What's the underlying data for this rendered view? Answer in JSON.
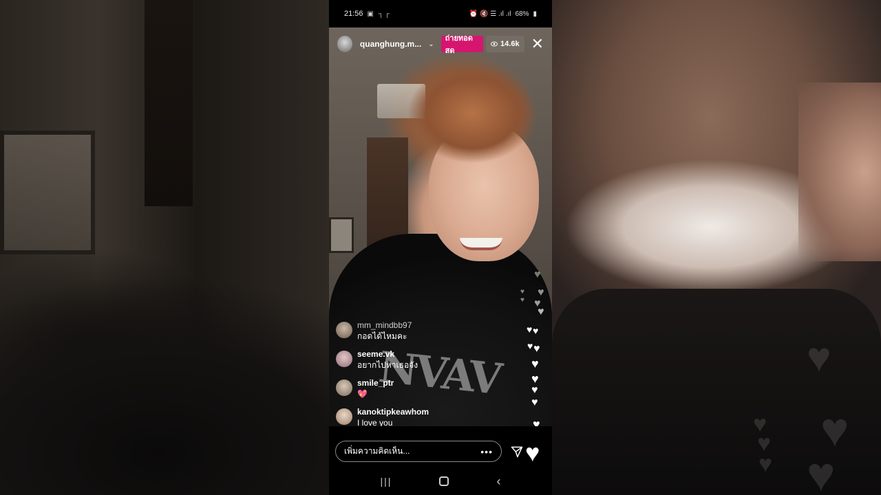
{
  "statusbar": {
    "time": "21:56",
    "left_icons": "▣ ┐┌",
    "right_icons": "⏰ 🔇 ☰ .ıl .ıl",
    "battery": "68%"
  },
  "live": {
    "host_name": "quanghung.m...",
    "live_label": "ถ่ายทอดสด",
    "viewer_count": "14.6k"
  },
  "comments": [
    {
      "username": "mm_mindbb97",
      "text": "กอดได้ไหมคะ"
    },
    {
      "username": "seeme.vk",
      "text": "อยากไปหาเธอจัง"
    },
    {
      "username": "smile_ptr",
      "text": "💖"
    },
    {
      "username": "kanoktipkeawhom",
      "text": "I love you"
    }
  ],
  "composer": {
    "placeholder": "เพิ่มความคิดเห็น...",
    "more": "•••"
  },
  "icons": {
    "close": "close-icon",
    "send": "send-icon",
    "heart": "heart-icon",
    "viewer": "eye-icon"
  },
  "colors": {
    "live_badge": "#d6156f",
    "viewer_badge": "#787068"
  }
}
